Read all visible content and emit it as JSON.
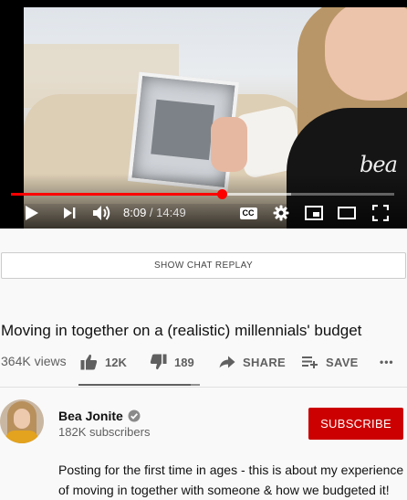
{
  "player": {
    "watermark": "bea",
    "current_time": "8:09",
    "separator": " / ",
    "duration": "14:49",
    "progress_fraction": 0.55,
    "buffered_fraction": 0.73,
    "icons": [
      "play-icon",
      "next-icon",
      "volume-icon",
      "captions-icon",
      "settings-icon",
      "miniplayer-icon",
      "theater-icon",
      "fullscreen-icon"
    ],
    "cc_label": "CC"
  },
  "chat_replay_label": "SHOW CHAT REPLAY",
  "video": {
    "title": "Moving in together on a (realistic) millennials' budget",
    "views": "364K views",
    "likes": "12K",
    "dislikes": "189",
    "share_label": "SHARE",
    "save_label": "SAVE",
    "more_label": "•••"
  },
  "channel": {
    "name": "Bea Jonite",
    "subscribers": "182K subscribers",
    "subscribe_label": "SUBSCRIBE"
  },
  "description": "Posting for the first time in ages - this is about my experience of moving in together with someone & how we budgeted it!",
  "colors": {
    "accent_red": "#ff0000",
    "subscribe_red": "#cc0000",
    "text_secondary": "#606060"
  }
}
